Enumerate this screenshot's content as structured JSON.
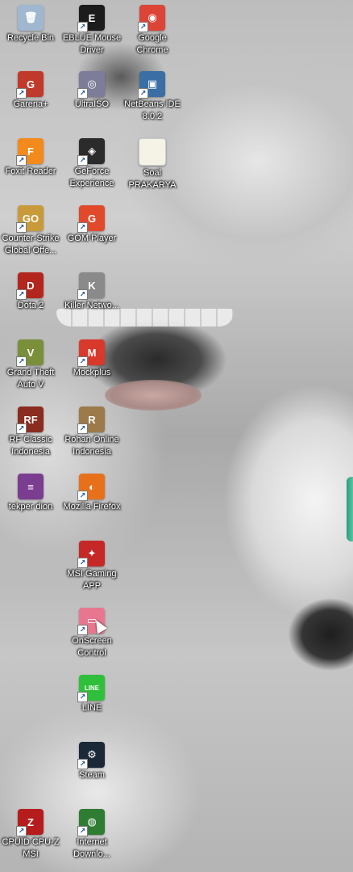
{
  "desktop": {
    "icons": [
      {
        "label": "Recycle Bin",
        "icon": "recycle-bin-icon",
        "color": "#9fb8cf",
        "glyph": "🗑",
        "shortcut": false
      },
      {
        "label": "EBLUE Mouse Driver",
        "icon": "eblue-mouse-driver-icon",
        "color": "#1c1c1c",
        "glyph": "E",
        "shortcut": true
      },
      {
        "label": "Google Chrome",
        "icon": "chrome-icon",
        "color": "#db4437",
        "glyph": "◉",
        "shortcut": true
      },
      {
        "label": "Garena+",
        "icon": "garena-icon",
        "color": "#c0392b",
        "glyph": "G",
        "shortcut": true
      },
      {
        "label": "UltraISO",
        "icon": "ultraiso-icon",
        "color": "#7d7d9a",
        "glyph": "◎",
        "shortcut": true
      },
      {
        "label": "NetBeans IDE 8.0.2",
        "icon": "netbeans-icon",
        "color": "#3a6ea5",
        "glyph": "▣",
        "shortcut": true
      },
      {
        "label": "Foxit Reader",
        "icon": "foxit-reader-icon",
        "color": "#f28a1c",
        "glyph": "F",
        "shortcut": true
      },
      {
        "label": "GeForce Experience",
        "icon": "geforce-icon",
        "color": "#2b2b2b",
        "glyph": "◈",
        "shortcut": true
      },
      {
        "label": "Soal PRAKARYA",
        "icon": "document-icon",
        "color": "#f5f2e6",
        "glyph": "",
        "shortcut": false
      },
      {
        "label": "Counter-Strike Global Offe...",
        "icon": "csgo-icon",
        "color": "#c99a3a",
        "glyph": "GO",
        "shortcut": true
      },
      {
        "label": "GOM Player",
        "icon": "gom-player-icon",
        "color": "#e04a2a",
        "glyph": "G",
        "shortcut": true
      },
      {
        "label": "Dota 2",
        "icon": "dota2-icon",
        "color": "#b3261e",
        "glyph": "D",
        "shortcut": true
      },
      {
        "label": "Killer Netwo...",
        "icon": "killer-network-icon",
        "color": "#8a8a8a",
        "glyph": "K",
        "shortcut": true
      },
      {
        "label": "Grand Theft Auto V",
        "icon": "gta-v-icon",
        "color": "#7a8f3a",
        "glyph": "V",
        "shortcut": true
      },
      {
        "label": "Mockplus",
        "icon": "mockplus-icon",
        "color": "#d9392b",
        "glyph": "M",
        "shortcut": true
      },
      {
        "label": "RF Classic Indonesia",
        "icon": "rf-classic-icon",
        "color": "#8a2c1f",
        "glyph": "RF",
        "shortcut": true
      },
      {
        "label": "Rohan Online Indonesia",
        "icon": "rohan-online-icon",
        "color": "#9c7a4a",
        "glyph": "R",
        "shortcut": true
      },
      {
        "label": "tekper dion",
        "icon": "winrar-archive-icon",
        "color": "#7a3d8f",
        "glyph": "≡",
        "shortcut": false
      },
      {
        "label": "Mozilla Firefox",
        "icon": "firefox-icon",
        "color": "#e8701a",
        "glyph": "◐",
        "shortcut": true
      },
      {
        "label": "MSI Gaming APP",
        "icon": "msi-gaming-app-icon",
        "color": "#c62828",
        "glyph": "✦",
        "shortcut": true
      },
      {
        "label": "OnScreen Control",
        "icon": "onscreen-control-icon",
        "color": "#e8768f",
        "glyph": "▭",
        "shortcut": true
      },
      {
        "label": "LINE",
        "icon": "line-icon",
        "color": "#2fbf3a",
        "glyph": "LINE",
        "shortcut": true
      },
      {
        "label": "Steam",
        "icon": "steam-icon",
        "color": "#1b2838",
        "glyph": "⚙",
        "shortcut": true
      },
      {
        "label": "CPUID CPU-Z MSI",
        "icon": "cpuz-icon",
        "color": "#b71c1c",
        "glyph": "Z",
        "shortcut": true
      },
      {
        "label": "Internet Downlo...",
        "icon": "internet-download-manager-icon",
        "color": "#2e7d32",
        "glyph": "◍",
        "shortcut": true
      }
    ]
  }
}
